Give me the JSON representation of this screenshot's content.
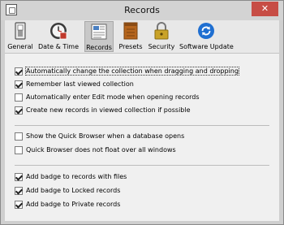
{
  "window": {
    "title": "Records",
    "close_label": "✕"
  },
  "toolbar": {
    "items": [
      {
        "label": "General",
        "icon": "switch-icon"
      },
      {
        "label": "Date & Time",
        "icon": "clock-icon"
      },
      {
        "label": "Records",
        "icon": "records-card-icon"
      },
      {
        "label": "Presets",
        "icon": "presets-box-icon"
      },
      {
        "label": "Security",
        "icon": "padlock-icon"
      },
      {
        "label": "Software Update",
        "icon": "update-refresh-icon"
      }
    ]
  },
  "options": {
    "group1": [
      {
        "label": "Automatically change the collection when dragging and dropping",
        "checked": true
      },
      {
        "label": "Remember last viewed collection",
        "checked": true
      },
      {
        "label": "Automatically enter Edit mode when opening records",
        "checked": false
      },
      {
        "label": "Create new records in viewed collection if possible",
        "checked": true
      }
    ],
    "group2": [
      {
        "label": "Show the Quick Browser when a database opens",
        "checked": false
      },
      {
        "label": "Quick Browser does not float over all windows",
        "checked": false
      }
    ],
    "group3": [
      {
        "label": "Add badge to records with files",
        "checked": true
      },
      {
        "label": "Add badge to Locked records",
        "checked": true
      },
      {
        "label": "Add badge to Private records",
        "checked": true
      }
    ]
  },
  "colors": {
    "close_button": "#c74d45",
    "titlebar": "#d3d3d3",
    "panel": "#f0f0f0"
  }
}
